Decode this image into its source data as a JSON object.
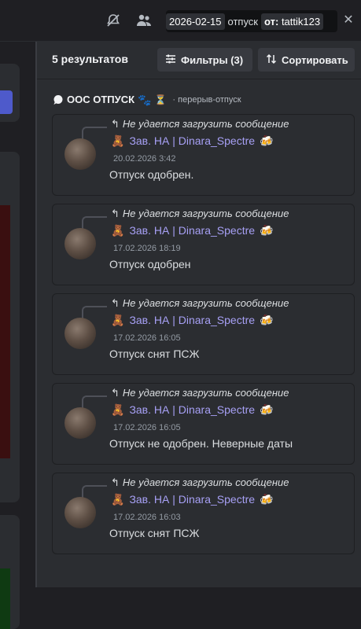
{
  "header": {
    "search_chips": [
      {
        "value": "2026-02-15"
      },
      {
        "word": "отпуск"
      },
      {
        "key": "от:",
        "value": "tattik123"
      }
    ]
  },
  "results": {
    "count_label": "5 результатов",
    "filters_label": "Фильтры (3)",
    "sort_label": "Сортировать",
    "channel": {
      "name": "ООС ОТПУСК",
      "subchannel": "перерыв-отпуск"
    },
    "items": [
      {
        "reply": "Не удается загрузить сообщение",
        "author": "Зав. НА | Dinara_Spectre",
        "timestamp": "20.02.2026 3:42",
        "message": "Отпуск одобрен."
      },
      {
        "reply": "Не удается загрузить сообщение",
        "author": "Зав. НА | Dinara_Spectre",
        "timestamp": "17.02.2026 18:19",
        "message": "Отпуск одобрен"
      },
      {
        "reply": "Не удается загрузить сообщение",
        "author": "Зав. НА | Dinara_Spectre",
        "timestamp": "17.02.2026 16:05",
        "message": "Отпуск снят ПСЖ"
      },
      {
        "reply": "Не удается загрузить сообщение",
        "author": "Зав. НА | Dinara_Spectre",
        "timestamp": "17.02.2026 16:05",
        "message": "Отпуск не одобрен. Неверные даты"
      },
      {
        "reply": "Не удается загрузить сообщение",
        "author": "Зав. НА | Dinara_Spectre",
        "timestamp": "17.02.2026 16:03",
        "message": "Отпуск снят ПСЖ"
      }
    ]
  },
  "icons": {
    "mute": "bell-slash-icon",
    "members": "members-icon",
    "close": "close-icon",
    "filters": "sliders-icon",
    "sort": "sort-arrows-icon",
    "reply": "reply-arrow-icon",
    "author_prefix": "bear-emoji",
    "author_suffix": "beer-emoji"
  },
  "colors": {
    "accent_name": "#a7a0f5",
    "panel_bg": "#2b2d31",
    "app_bg": "#1f1f23"
  }
}
